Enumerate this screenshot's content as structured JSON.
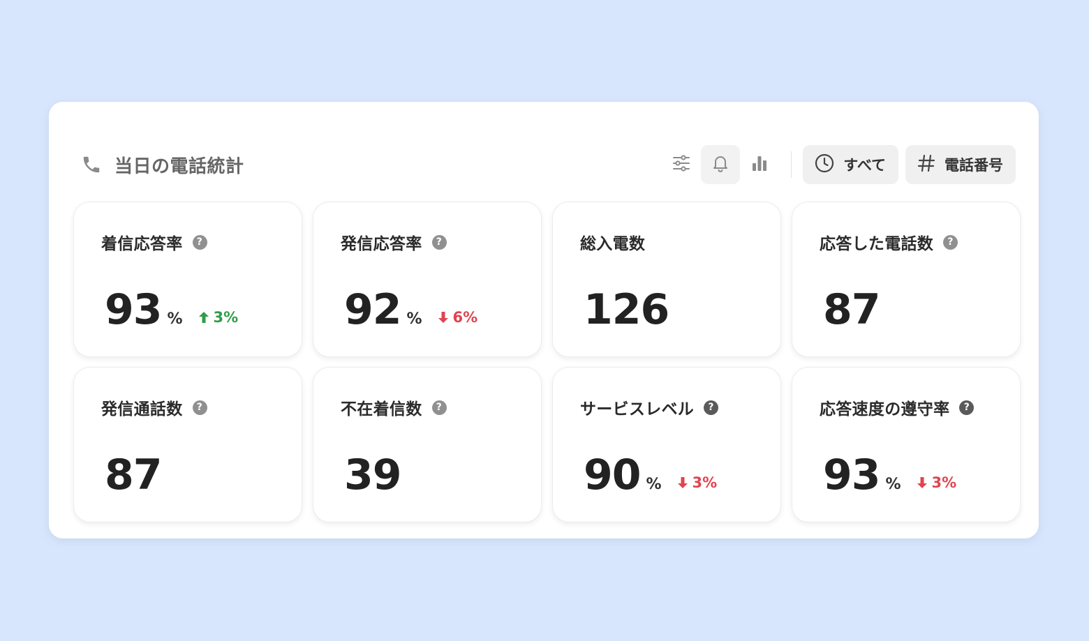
{
  "header": {
    "title": "当日の電話統計",
    "filter_all_label": "すべて",
    "phone_number_label": "電話番号"
  },
  "colors": {
    "background": "#d8e6fd",
    "up": "#2e9d49",
    "down": "#e0444f"
  },
  "cards": [
    {
      "label": "着信応答率",
      "value": "93",
      "unit": "%",
      "delta": "3%",
      "trend": "up",
      "help": "?"
    },
    {
      "label": "発信応答率",
      "value": "92",
      "unit": "%",
      "delta": "6%",
      "trend": "down",
      "help": "?"
    },
    {
      "label": "総入電数",
      "value": "126"
    },
    {
      "label": "応答した電話数",
      "value": "87",
      "help": "?"
    },
    {
      "label": "発信通話数",
      "value": "87",
      "help": "?"
    },
    {
      "label": "不在着信数",
      "value": "39",
      "help": "?"
    },
    {
      "label": "サービスレベル",
      "value": "90",
      "unit": "%",
      "delta": "3%",
      "trend": "down",
      "help": "?"
    },
    {
      "label": "応答速度の遵守率",
      "value": "93",
      "unit": "%",
      "delta": "3%",
      "trend": "down",
      "help": "?"
    }
  ]
}
